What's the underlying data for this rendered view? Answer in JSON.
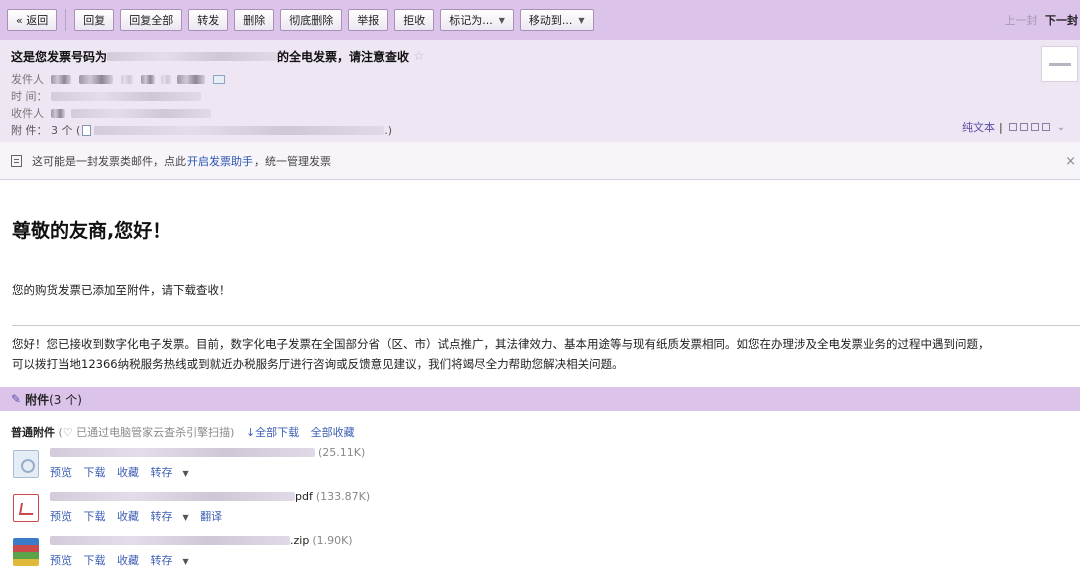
{
  "toolbar": {
    "back": "« 返回",
    "reply": "回复",
    "reply_all": "回复全部",
    "forward": "转发",
    "delete": "删除",
    "delete_forever": "彻底删除",
    "report": "举报",
    "reject": "拒收",
    "mark_as": "标记为...",
    "move_to": "移动到...",
    "prev_mail": "上一封",
    "next_mail": "下一封"
  },
  "header": {
    "subject_prefix": "这是您发票号码为",
    "subject_suffix": "的全电发票，请注意查收",
    "star_icon": "star-icon",
    "from_label": "发件人",
    "time_label": "时 间：",
    "to_label": "收件人",
    "attach_label": "附 件：",
    "attach_count": "3 个 (",
    "attach_close": ".)",
    "plain_text": "纯文本",
    "plain_sep": "|"
  },
  "notice": {
    "text_before": "这可能是一封发票类邮件，点此",
    "link": "开启发票助手",
    "text_after": "，统一管理发票",
    "close": "×"
  },
  "body": {
    "greeting": "尊敬的友商,您好！",
    "line1": "您的购货发票已添加至附件，请下载查收！",
    "para_line1": "您好！您已接收到数字化电子发票。目前，数字化电子发票在全国部分省（区、市）试点推广，其法律效力、基本用途等与现有纸质发票相同。如您在办理涉及全电发票业务的过程中遇到问题，",
    "para_line2": "可以拨打当地12366纳税服务热线或到就近办税服务厅进行咨询或反馈意见建议，我们将竭尽全力帮助您解决相关问题。"
  },
  "attachments": {
    "title": "附件",
    "count": "(3 个)",
    "normal_title": "普通附件",
    "scan_text": "(♡ 已通过电脑管家云查杀引擎扫描)",
    "download_all": "↓全部下载",
    "favorite_all": "全部收藏",
    "files": [
      {
        "ext": "",
        "size": "(25.11K)",
        "actions": [
          "预览",
          "下载",
          "收藏",
          "转存"
        ]
      },
      {
        "ext": "pdf",
        "size": "(133.87K)",
        "actions": [
          "预览",
          "下载",
          "收藏",
          "转存",
          "翻译"
        ]
      },
      {
        "ext": ".zip",
        "size": "(1.90K)",
        "actions": [
          "预览",
          "下载",
          "收藏",
          "转存"
        ]
      }
    ]
  },
  "colors": {
    "toolbar_bg": "#dcc3ea",
    "header_bg": "#efe6f4",
    "link": "#3d5fb3"
  }
}
